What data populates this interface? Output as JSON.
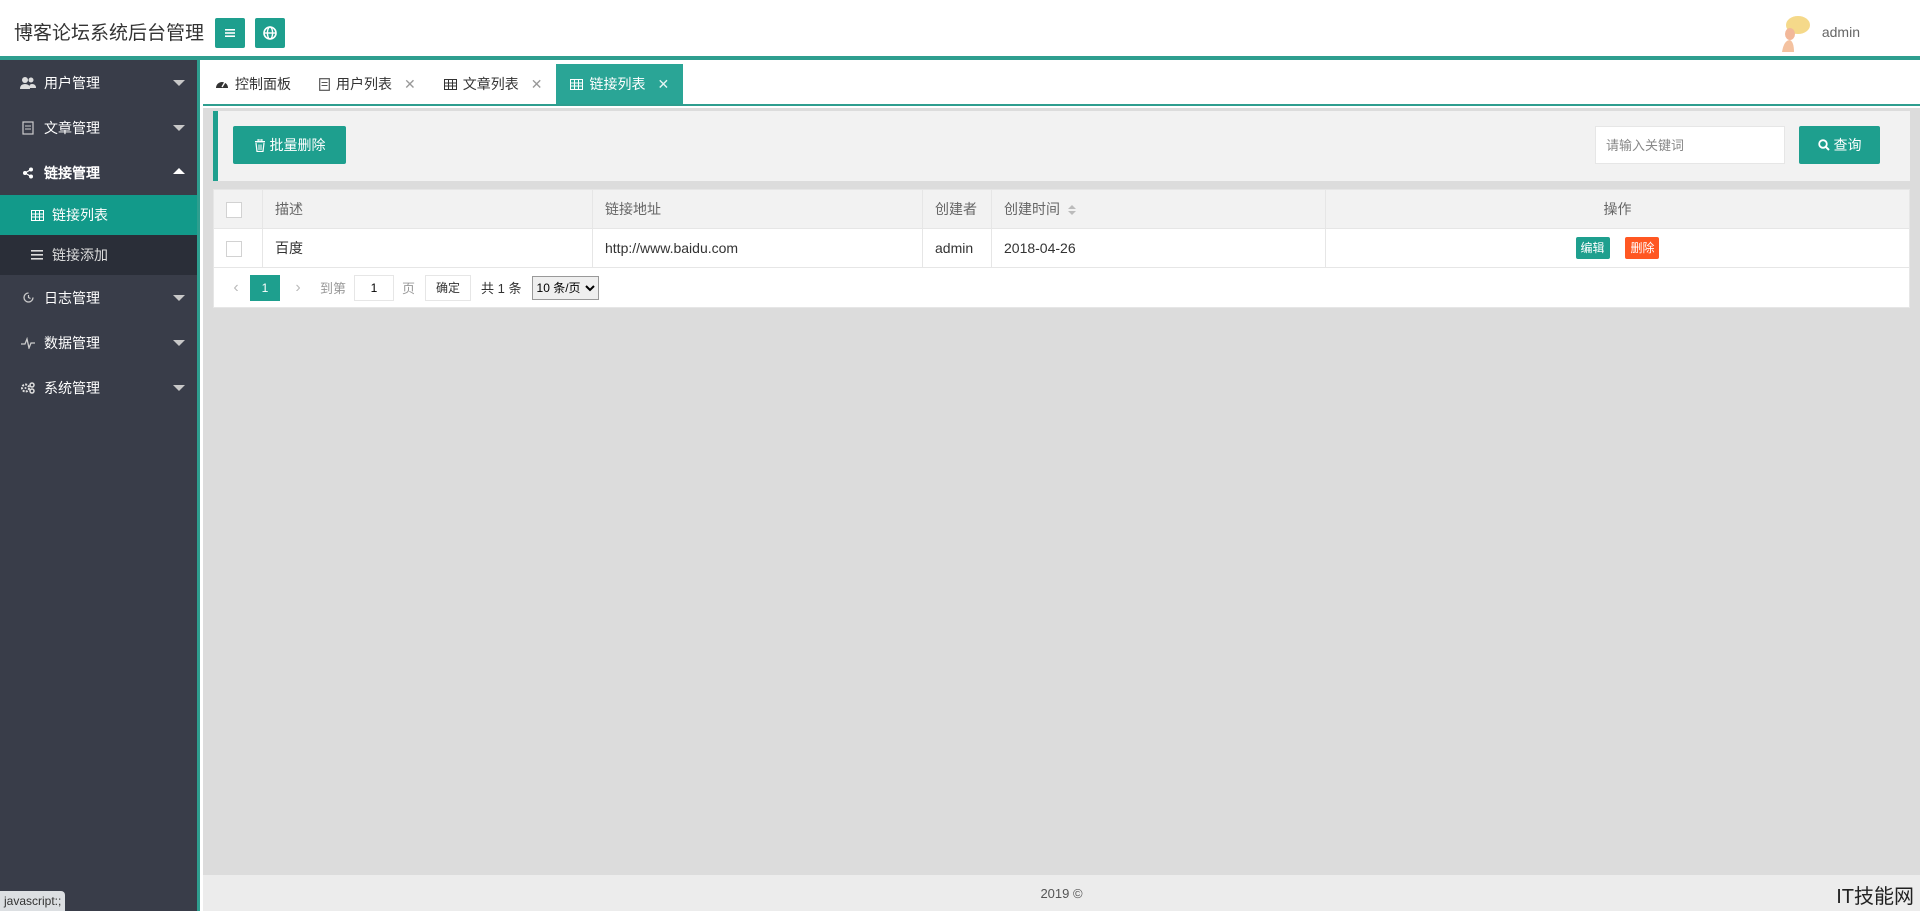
{
  "header": {
    "brand": "博客论坛系统后台管理",
    "user_name": "admin"
  },
  "sidebar": {
    "items": [
      {
        "label": "用户管理",
        "icon": "users-icon"
      },
      {
        "label": "文章管理",
        "icon": "document-icon"
      },
      {
        "label": "链接管理",
        "icon": "share-icon",
        "expanded": true,
        "children": [
          {
            "label": "链接列表",
            "icon": "table-icon",
            "active": true
          },
          {
            "label": "链接添加",
            "icon": "list-icon"
          }
        ]
      },
      {
        "label": "日志管理",
        "icon": "log-icon"
      },
      {
        "label": "数据管理",
        "icon": "pulse-icon"
      },
      {
        "label": "系统管理",
        "icon": "gears-icon"
      }
    ]
  },
  "tabs": [
    {
      "label": "控制面板",
      "icon": "dashboard-icon",
      "closable": false
    },
    {
      "label": "用户列表",
      "icon": "document-icon",
      "closable": true
    },
    {
      "label": "文章列表",
      "icon": "table-icon",
      "closable": true
    },
    {
      "label": "链接列表",
      "icon": "table-icon",
      "closable": true,
      "active": true
    }
  ],
  "toolbar": {
    "batch_delete_label": "批量删除",
    "search_placeholder": "请输入关键词",
    "query_label": "查询"
  },
  "table": {
    "columns": [
      "描述",
      "链接地址",
      "创建者",
      "创建时间",
      "操作"
    ],
    "rows": [
      {
        "desc": "百度",
        "url": "http://www.baidu.com",
        "creator": "admin",
        "created": "2018-04-26"
      }
    ],
    "edit_label": "编辑",
    "delete_label": "删除"
  },
  "pager": {
    "current": "1",
    "goto_prefix": "到第",
    "goto_value": "1",
    "goto_suffix": "页",
    "confirm_label": "确定",
    "total": "共 1 条",
    "page_size": "10 条/页"
  },
  "footer": "2019 ©",
  "status_tip": "javascript:;",
  "watermark": "IT技能网",
  "colors": {
    "accent": "#1e9f8e",
    "danger": "#ff5722",
    "sidebar": "#393d49"
  }
}
